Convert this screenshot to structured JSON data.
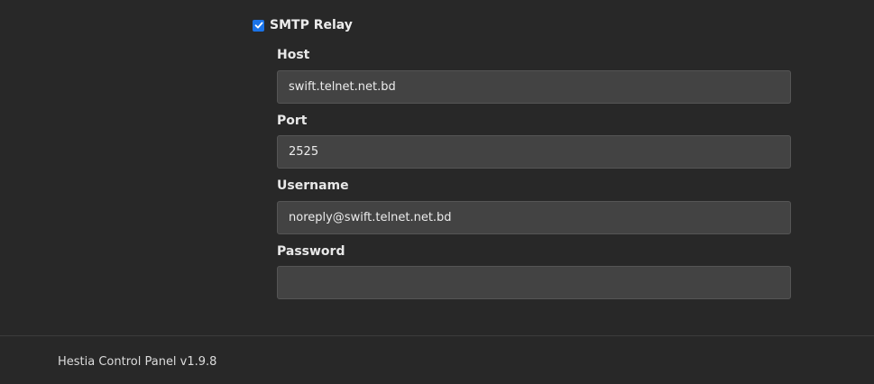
{
  "smtp_relay": {
    "label": "SMTP Relay",
    "checked": true
  },
  "fields": {
    "host": {
      "label": "Host",
      "value": "swift.telnet.net.bd"
    },
    "port": {
      "label": "Port",
      "value": "2525"
    },
    "username": {
      "label": "Username",
      "value": "noreply@swift.telnet.net.bd"
    },
    "password": {
      "label": "Password",
      "value": ""
    }
  },
  "footer": {
    "text": "Hestia Control Panel v1.9.8"
  },
  "colors": {
    "background": "#282828",
    "input_background": "#434343",
    "checkbox_accent": "#1a73e8"
  }
}
